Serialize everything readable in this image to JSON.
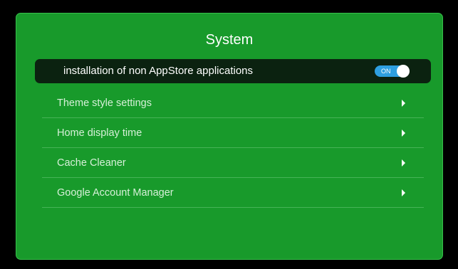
{
  "screen": {
    "title": "System"
  },
  "items": [
    {
      "label": "installation of non AppStore applications",
      "toggle": "ON"
    },
    {
      "label": "Theme style settings"
    },
    {
      "label": "Home display time"
    },
    {
      "label": "Cache Cleaner"
    },
    {
      "label": "Google Account Manager"
    }
  ],
  "colors": {
    "panel_bg": "#189a2b",
    "selected_row_bg": "#0b2210",
    "toggle_on": "#2e9fe0",
    "divider": "#46b357"
  },
  "icons": {
    "row_arrow": "chevron-right-icon"
  }
}
